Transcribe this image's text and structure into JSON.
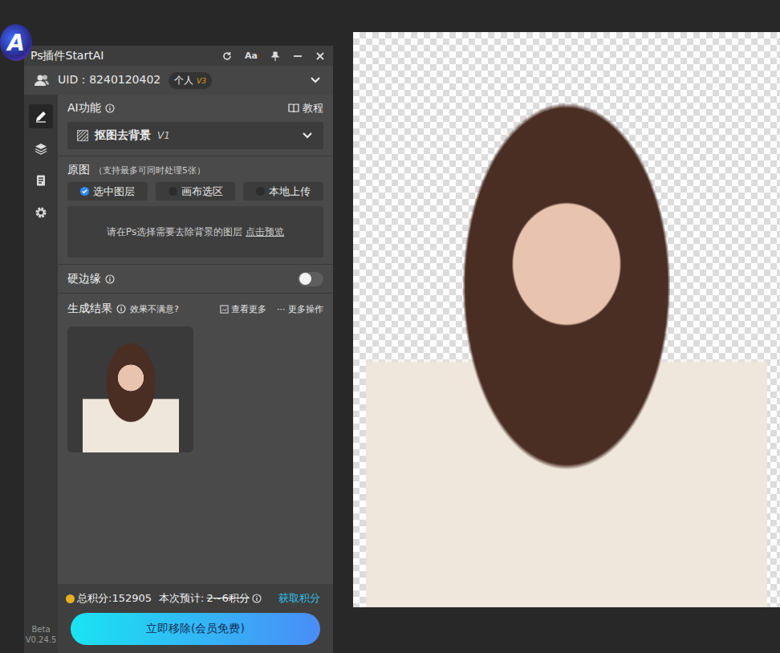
{
  "logo": {
    "text": "A"
  },
  "title_bar": {
    "title": "Ps插件StartAI",
    "font_button": "Aa"
  },
  "user": {
    "uid": "UID：8240120402",
    "plan": "个人",
    "level": "V3"
  },
  "rail": {
    "items": [
      {
        "kind": "pen",
        "selected": true
      },
      {
        "kind": "layers",
        "selected": false
      },
      {
        "kind": "notes",
        "selected": false
      },
      {
        "kind": "settings",
        "selected": false
      }
    ]
  },
  "version": {
    "stage": "Beta",
    "number": "V0.24.5"
  },
  "ai": {
    "label": "AI功能",
    "tutorial": "教程",
    "feature": "抠图去背景",
    "feature_version": "V1"
  },
  "source": {
    "label": "原图",
    "hint": "（支持最多可同时处理5张）",
    "options": [
      {
        "label": "选中图层",
        "selected": true
      },
      {
        "label": "画布选区",
        "selected": false
      },
      {
        "label": "本地上传",
        "selected": false
      }
    ],
    "prompt": "请在Ps选择需要去除背景的图层",
    "preview_link": "点击预览"
  },
  "hard_edge": {
    "label": "硬边缘",
    "on": false
  },
  "results": {
    "label": "生成结果",
    "feedback": "效果不满意?",
    "more": "查看更多",
    "more_actions_icon": "···",
    "more_actions": "更多操作"
  },
  "footer": {
    "total": "总积分:152905",
    "estimate_label": "本次预计:",
    "estimate": "2~6积分",
    "estimate_struck": true,
    "get_points": "获取积分",
    "action": "立即移除(会员免费)"
  }
}
